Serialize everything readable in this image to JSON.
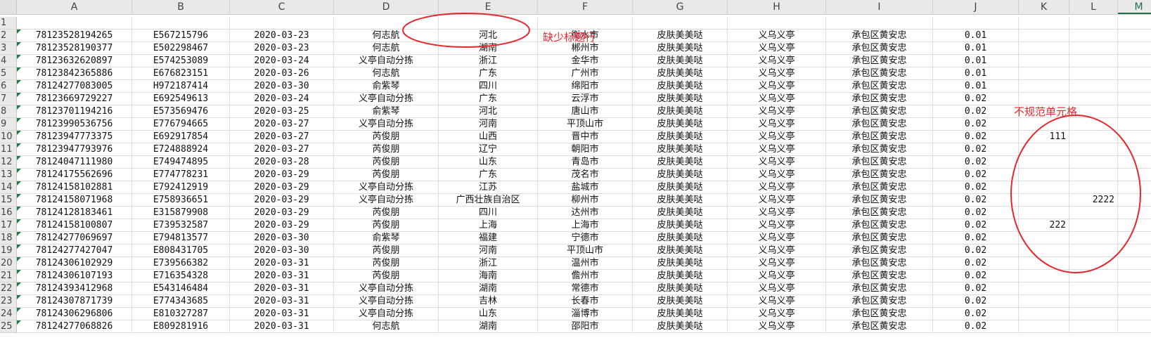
{
  "columns": [
    "A",
    "B",
    "C",
    "D",
    "E",
    "F",
    "G",
    "H",
    "I",
    "J",
    "K",
    "L",
    "M"
  ],
  "rows": [
    {
      "n": "1",
      "cells": [
        "",
        "",
        "",
        "",
        "",
        "",
        "",
        "",
        "",
        "",
        "",
        "",
        ""
      ]
    },
    {
      "n": "2",
      "cells": [
        "78123528194265",
        "E567215796",
        "2020-03-23",
        "何志航",
        "河北",
        "衡水市",
        "皮肤美美哒",
        "义乌义亭",
        "承包区黄安忠",
        "0.01",
        "",
        "",
        ""
      ]
    },
    {
      "n": "3",
      "cells": [
        "78123528190377",
        "E502298467",
        "2020-03-23",
        "何志航",
        "湖南",
        "郴州市",
        "皮肤美美哒",
        "义乌义亭",
        "承包区黄安忠",
        "0.01",
        "",
        "",
        ""
      ]
    },
    {
      "n": "4",
      "cells": [
        "78123632620897",
        "E574253089",
        "2020-03-24",
        "义亭自动分拣",
        "浙江",
        "金华市",
        "皮肤美美哒",
        "义乌义亭",
        "承包区黄安忠",
        "0.01",
        "",
        "",
        ""
      ]
    },
    {
      "n": "5",
      "cells": [
        "78123842365886",
        "E676823151",
        "2020-03-26",
        "何志航",
        "广东",
        "广州市",
        "皮肤美美哒",
        "义乌义亭",
        "承包区黄安忠",
        "0.01",
        "",
        "",
        ""
      ]
    },
    {
      "n": "6",
      "cells": [
        "78124277083005",
        "H972187414",
        "2020-03-30",
        "俞紫琴",
        "四川",
        "绵阳市",
        "皮肤美美哒",
        "义乌义亭",
        "承包区黄安忠",
        "0.01",
        "",
        "",
        ""
      ]
    },
    {
      "n": "7",
      "cells": [
        "78123669729227",
        "E692549613",
        "2020-03-24",
        "义亭自动分拣",
        "广东",
        "云浮市",
        "皮肤美美哒",
        "义乌义亭",
        "承包区黄安忠",
        "0.02",
        "",
        "",
        ""
      ]
    },
    {
      "n": "8",
      "cells": [
        "78123701194216",
        "E573569476",
        "2020-03-25",
        "俞紫琴",
        "河北",
        "唐山市",
        "皮肤美美哒",
        "义乌义亭",
        "承包区黄安忠",
        "0.02",
        "",
        "",
        ""
      ]
    },
    {
      "n": "9",
      "cells": [
        "78123990536756",
        "E776794665",
        "2020-03-27",
        "义亭自动分拣",
        "河南",
        "平顶山市",
        "皮肤美美哒",
        "义乌义亭",
        "承包区黄安忠",
        "0.02",
        "",
        "",
        ""
      ]
    },
    {
      "n": "10",
      "cells": [
        "78123947773375",
        "E692917854",
        "2020-03-27",
        "芮俊朋",
        "山西",
        "晋中市",
        "皮肤美美哒",
        "义乌义亭",
        "承包区黄安忠",
        "0.02",
        "111",
        "",
        ""
      ]
    },
    {
      "n": "11",
      "cells": [
        "78123947793976",
        "E724888924",
        "2020-03-27",
        "芮俊朋",
        "辽宁",
        "朝阳市",
        "皮肤美美哒",
        "义乌义亭",
        "承包区黄安忠",
        "0.02",
        "",
        "",
        ""
      ]
    },
    {
      "n": "12",
      "cells": [
        "78124047111980",
        "E749474895",
        "2020-03-28",
        "芮俊朋",
        "山东",
        "青岛市",
        "皮肤美美哒",
        "义乌义亭",
        "承包区黄安忠",
        "0.02",
        "",
        "",
        ""
      ]
    },
    {
      "n": "13",
      "cells": [
        "78124175562696",
        "E774778231",
        "2020-03-29",
        "芮俊朋",
        "广东",
        "茂名市",
        "皮肤美美哒",
        "义乌义亭",
        "承包区黄安忠",
        "0.02",
        "",
        "",
        ""
      ]
    },
    {
      "n": "14",
      "cells": [
        "78124158102881",
        "E792412919",
        "2020-03-29",
        "义亭自动分拣",
        "江苏",
        "盐城市",
        "皮肤美美哒",
        "义乌义亭",
        "承包区黄安忠",
        "0.02",
        "",
        "",
        ""
      ]
    },
    {
      "n": "15",
      "cells": [
        "78124158071968",
        "E758936651",
        "2020-03-29",
        "义亭自动分拣",
        "广西壮族自治区",
        "柳州市",
        "皮肤美美哒",
        "义乌义亭",
        "承包区黄安忠",
        "0.02",
        "",
        "2222",
        ""
      ]
    },
    {
      "n": "16",
      "cells": [
        "78124128183461",
        "E315879908",
        "2020-03-29",
        "芮俊朋",
        "四川",
        "达州市",
        "皮肤美美哒",
        "义乌义亭",
        "承包区黄安忠",
        "0.02",
        "",
        "",
        ""
      ]
    },
    {
      "n": "17",
      "cells": [
        "78124158100807",
        "E739532587",
        "2020-03-29",
        "芮俊朋",
        "上海",
        "上海市",
        "皮肤美美哒",
        "义乌义亭",
        "承包区黄安忠",
        "0.02",
        "222",
        "",
        ""
      ]
    },
    {
      "n": "18",
      "cells": [
        "78124277069697",
        "E794813577",
        "2020-03-30",
        "俞紫琴",
        "福建",
        "宁德市",
        "皮肤美美哒",
        "义乌义亭",
        "承包区黄安忠",
        "0.02",
        "",
        "",
        ""
      ]
    },
    {
      "n": "19",
      "cells": [
        "78124277427047",
        "E808431705",
        "2020-03-30",
        "芮俊朋",
        "河南",
        "平顶山市",
        "皮肤美美哒",
        "义乌义亭",
        "承包区黄安忠",
        "0.02",
        "",
        "",
        ""
      ]
    },
    {
      "n": "20",
      "cells": [
        "78124306102929",
        "E739566382",
        "2020-03-31",
        "芮俊朋",
        "浙江",
        "温州市",
        "皮肤美美哒",
        "义乌义亭",
        "承包区黄安忠",
        "0.02",
        "",
        "",
        ""
      ]
    },
    {
      "n": "21",
      "cells": [
        "78124306107193",
        "E716354328",
        "2020-03-31",
        "芮俊朋",
        "海南",
        "儋州市",
        "皮肤美美哒",
        "义乌义亭",
        "承包区黄安忠",
        "0.02",
        "",
        "",
        ""
      ]
    },
    {
      "n": "22",
      "cells": [
        "78124393412968",
        "E543146484",
        "2020-03-31",
        "义亭自动分拣",
        "湖南",
        "常德市",
        "皮肤美美哒",
        "义乌义亭",
        "承包区黄安忠",
        "0.02",
        "",
        "",
        ""
      ]
    },
    {
      "n": "23",
      "cells": [
        "78124307871739",
        "E774343685",
        "2020-03-31",
        "义亭自动分拣",
        "吉林",
        "长春市",
        "皮肤美美哒",
        "义乌义亭",
        "承包区黄安忠",
        "0.02",
        "",
        "",
        ""
      ]
    },
    {
      "n": "24",
      "cells": [
        "78124306296806",
        "E810327287",
        "2020-03-31",
        "义亭自动分拣",
        "山东",
        "淄博市",
        "皮肤美美哒",
        "义乌义亭",
        "承包区黄安忠",
        "0.02",
        "",
        "",
        ""
      ]
    },
    {
      "n": "25",
      "cells": [
        "78124277068826",
        "E809281916",
        "2020-03-31",
        "何志航",
        "湖南",
        "邵阳市",
        "皮肤美美哒",
        "义乌义亭",
        "承包区黄安忠",
        "0.02",
        "",
        "",
        ""
      ]
    }
  ],
  "annotations": {
    "missing_header": "缺少标题行",
    "irregular_cells": "不规范单元格"
  },
  "colors": {
    "annotation": "#e8262d",
    "selected_column": "#217346",
    "triangle": "#1f7a44"
  }
}
